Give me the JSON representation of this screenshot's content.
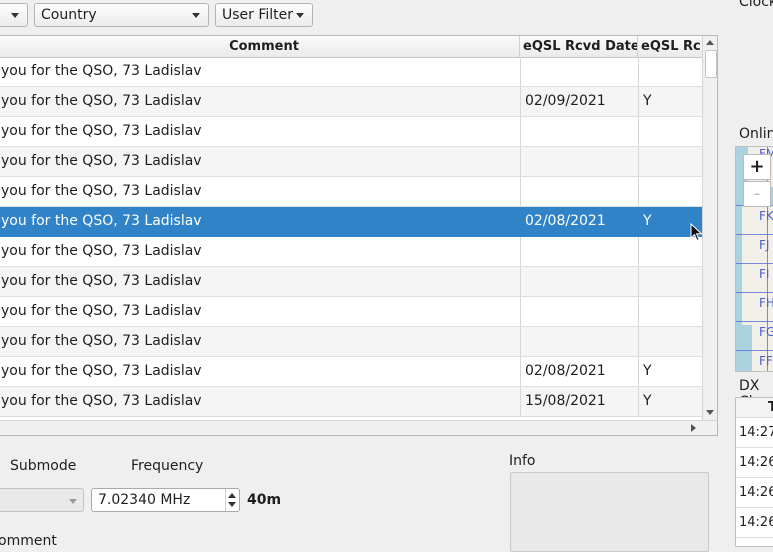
{
  "filters": {
    "first_combo_value": "",
    "country_combo_value": "Country",
    "user_filter_value": "User Filter"
  },
  "table": {
    "columns": [
      "Comment",
      "eQSL Rcvd Date",
      "eQSL Rc"
    ],
    "rows": [
      {
        "comment": "you for the QSO, 73 Ladislav",
        "rcvd_date": "",
        "rcvd": ""
      },
      {
        "comment": "you for the QSO, 73 Ladislav",
        "rcvd_date": "02/09/2021",
        "rcvd": "Y"
      },
      {
        "comment": "you for the QSO, 73 Ladislav",
        "rcvd_date": "",
        "rcvd": ""
      },
      {
        "comment": "you for the QSO, 73 Ladislav",
        "rcvd_date": "",
        "rcvd": ""
      },
      {
        "comment": "you for the QSO, 73 Ladislav",
        "rcvd_date": "",
        "rcvd": ""
      },
      {
        "comment": "you for the QSO, 73 Ladislav",
        "rcvd_date": "02/08/2021",
        "rcvd": "Y",
        "selected": true
      },
      {
        "comment": "you for the QSO, 73 Ladislav",
        "rcvd_date": "",
        "rcvd": ""
      },
      {
        "comment": "you for the QSO, 73 Ladislav",
        "rcvd_date": "",
        "rcvd": ""
      },
      {
        "comment": "you for the QSO, 73 Ladislav",
        "rcvd_date": "",
        "rcvd": ""
      },
      {
        "comment": "you for the QSO, 73 Ladislav",
        "rcvd_date": "",
        "rcvd": ""
      },
      {
        "comment": "you for the QSO, 73 Ladislav",
        "rcvd_date": "02/08/2021",
        "rcvd": "Y"
      },
      {
        "comment": "you for the QSO, 73 Ladislav",
        "rcvd_date": "15/08/2021",
        "rcvd": "Y"
      }
    ],
    "selection_color": "#3083c6"
  },
  "form": {
    "submode_label": "Submode",
    "frequency_label": "Frequency",
    "frequency_value": "7.02340 MHz",
    "band": "40m",
    "comment_label": "omment",
    "info_label": "Info"
  },
  "right": {
    "clock_label": "Clock",
    "online_map_label": "Onlin",
    "zoom_in": "+",
    "zoom_out": "-",
    "map_locators": [
      "FM",
      "FK",
      "FJ",
      "FI",
      "FH",
      "FG",
      "FF"
    ],
    "dx_label": "DX Cl",
    "dx_header": "T",
    "dx_times": [
      "14:27",
      "14:26",
      "14:26",
      "14:26"
    ]
  },
  "icons": {
    "dropdown": "chevron-down-icon",
    "scroll_up": "arrow-up-icon",
    "scroll_down": "arrow-down-icon",
    "scroll_right": "arrow-right-icon",
    "cursor": "mouse-pointer-icon"
  }
}
